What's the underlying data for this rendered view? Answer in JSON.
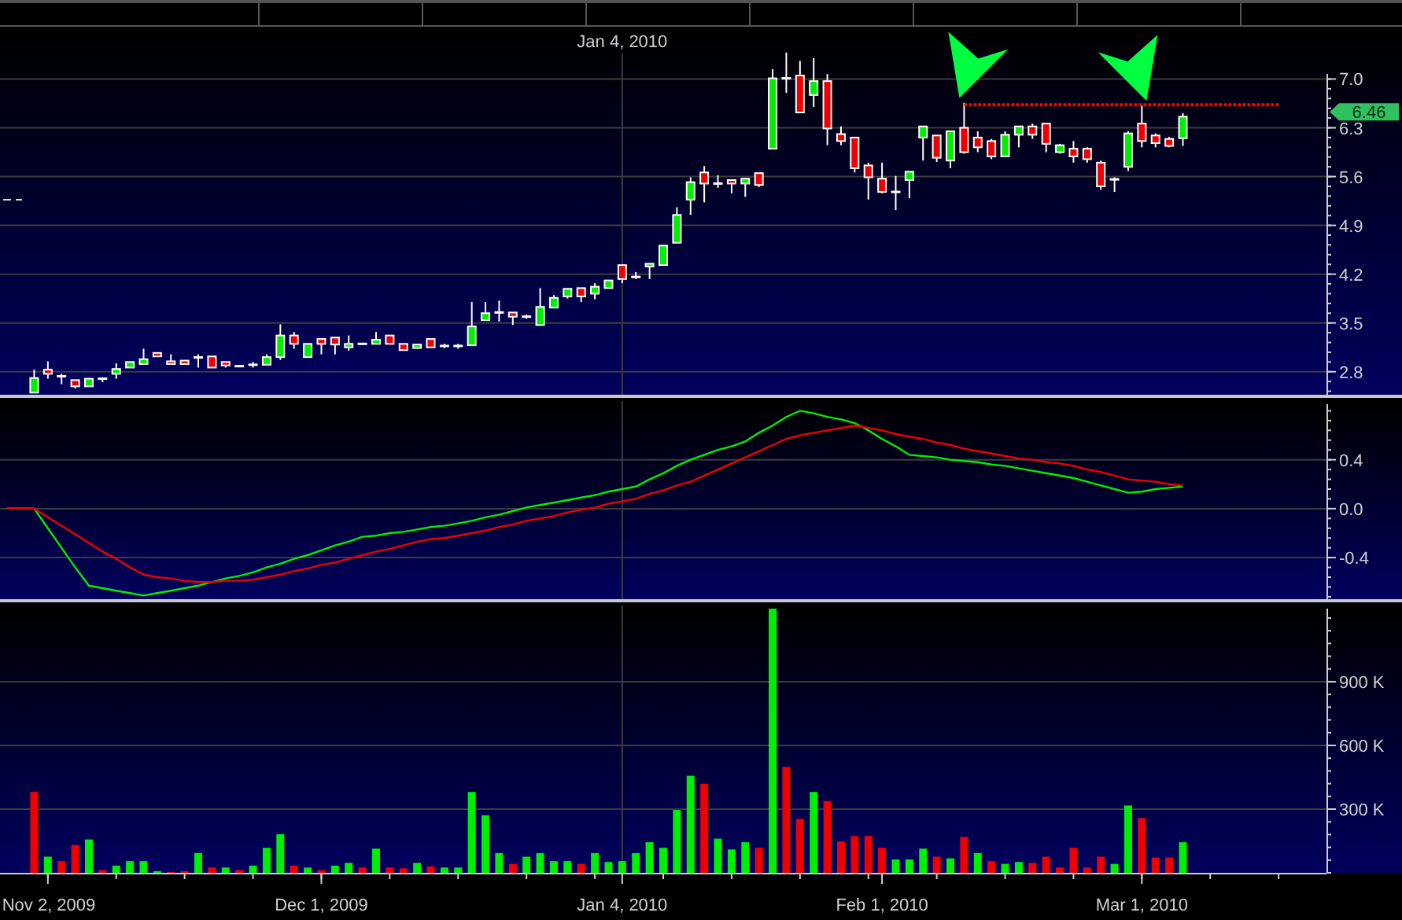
{
  "price_panel": {
    "price_tag": "6.46",
    "chart_data": {
      "type": "candlestick",
      "grid": true,
      "ylim": [
        2.47,
        7.75
      ],
      "categories": [
        null,
        null,
        null,
        null,
        null,
        null,
        null,
        null,
        null,
        null,
        null,
        null,
        null,
        null,
        null,
        null,
        null,
        null,
        null,
        null,
        null,
        null,
        null,
        null,
        null,
        null,
        null,
        null,
        null,
        null,
        null,
        null,
        null,
        null,
        null,
        null,
        null,
        null,
        null,
        null,
        null,
        null,
        null,
        null,
        null,
        null,
        null,
        null,
        null,
        null,
        null,
        null,
        null,
        null,
        null,
        null,
        null,
        null,
        null,
        null,
        null,
        null,
        null,
        null,
        null,
        null,
        null,
        null,
        null,
        null,
        null,
        null,
        null,
        null,
        null,
        null,
        null,
        null,
        null,
        null,
        null,
        null,
        null,
        null,
        null,
        null,
        null,
        null,
        null,
        null,
        null,
        null,
        null,
        null,
        null,
        null,
        null
      ],
      "yticks": [
        {
          "value": 2.8,
          "label": "2.8"
        },
        {
          "value": 3.5,
          "label": "3.5"
        },
        {
          "value": 4.2,
          "label": "4.2"
        },
        {
          "value": 4.9,
          "label": "4.9"
        },
        {
          "value": 5.6,
          "label": "5.6"
        },
        {
          "value": 6.3,
          "label": "6.3"
        },
        {
          "value": 7.0,
          "label": "7.0"
        }
      ],
      "ohlc": [
        null,
        null,
        [
          2.5,
          2.83,
          2.5,
          2.71
        ],
        [
          2.83,
          2.95,
          2.7,
          2.77
        ],
        [
          2.74,
          2.77,
          2.62,
          2.73
        ],
        [
          2.68,
          2.68,
          2.56,
          2.59
        ],
        [
          2.59,
          2.7,
          2.59,
          2.7
        ],
        [
          2.71,
          2.71,
          2.65,
          2.69
        ],
        [
          2.77,
          2.92,
          2.7,
          2.84
        ],
        [
          2.86,
          2.94,
          2.86,
          2.94
        ],
        [
          2.91,
          3.13,
          2.91,
          2.98
        ],
        [
          3.07,
          3.07,
          3.02,
          3.02
        ],
        [
          2.95,
          3.05,
          2.91,
          2.91
        ],
        [
          2.96,
          2.96,
          2.91,
          2.91
        ],
        [
          3.01,
          3.05,
          2.86,
          3.0
        ],
        [
          3.02,
          3.02,
          2.86,
          2.86
        ],
        [
          2.94,
          2.94,
          2.86,
          2.89
        ],
        [
          2.88,
          2.88,
          2.88,
          2.88
        ],
        [
          2.9,
          2.94,
          2.86,
          2.9
        ],
        [
          2.9,
          3.05,
          2.9,
          3.01
        ],
        [
          3.01,
          3.48,
          2.97,
          3.32
        ],
        [
          3.32,
          3.37,
          3.13,
          3.2
        ],
        [
          3.01,
          3.2,
          3.01,
          3.2
        ],
        [
          3.27,
          3.27,
          3.05,
          3.2
        ],
        [
          3.29,
          3.29,
          3.05,
          3.19
        ],
        [
          3.15,
          3.32,
          3.1,
          3.2
        ],
        [
          3.2,
          3.2,
          3.2,
          3.2
        ],
        [
          3.2,
          3.37,
          3.2,
          3.26
        ],
        [
          3.32,
          3.32,
          3.2,
          3.2
        ],
        [
          3.2,
          3.2,
          3.11,
          3.11
        ],
        [
          3.14,
          3.19,
          3.14,
          3.19
        ],
        [
          3.27,
          3.27,
          3.15,
          3.15
        ],
        [
          3.17,
          3.2,
          3.14,
          3.17
        ],
        [
          3.17,
          3.2,
          3.13,
          3.17
        ],
        [
          3.18,
          3.8,
          3.18,
          3.45
        ],
        [
          3.54,
          3.8,
          3.54,
          3.64
        ],
        [
          3.65,
          3.82,
          3.52,
          3.65
        ],
        [
          3.65,
          3.65,
          3.47,
          3.59
        ],
        [
          3.59,
          3.62,
          3.56,
          3.59
        ],
        [
          3.47,
          4.0,
          3.47,
          3.73
        ],
        [
          3.72,
          3.9,
          3.72,
          3.86
        ],
        [
          3.88,
          3.99,
          3.85,
          3.99
        ],
        [
          4.0,
          4.0,
          3.8,
          3.88
        ],
        [
          3.92,
          4.07,
          3.84,
          4.02
        ],
        [
          4.0,
          4.11,
          4.0,
          4.11
        ],
        [
          4.33,
          4.33,
          4.07,
          4.13
        ],
        [
          4.16,
          4.23,
          4.13,
          4.16
        ],
        [
          4.31,
          4.35,
          4.13,
          4.35
        ],
        [
          4.33,
          4.61,
          4.33,
          4.61
        ],
        [
          4.65,
          5.16,
          4.65,
          5.05
        ],
        [
          5.27,
          5.59,
          5.05,
          5.52
        ],
        [
          5.66,
          5.75,
          5.23,
          5.5
        ],
        [
          5.5,
          5.62,
          5.44,
          5.5
        ],
        [
          5.55,
          5.55,
          5.36,
          5.5
        ],
        [
          5.5,
          5.57,
          5.31,
          5.57
        ],
        [
          5.65,
          5.65,
          5.45,
          5.48
        ],
        [
          6.0,
          7.14,
          6.0,
          7.01
        ],
        [
          7.01,
          7.38,
          6.8,
          7.01
        ],
        [
          7.05,
          7.26,
          6.52,
          6.52
        ],
        [
          6.77,
          7.3,
          6.6,
          6.97
        ],
        [
          6.97,
          7.07,
          6.05,
          6.29
        ],
        [
          6.21,
          6.32,
          6.05,
          6.11
        ],
        [
          6.16,
          6.16,
          5.66,
          5.72
        ],
        [
          5.76,
          5.8,
          5.27,
          5.59
        ],
        [
          5.57,
          5.8,
          5.36,
          5.38
        ],
        [
          5.38,
          5.61,
          5.12,
          5.38
        ],
        [
          5.55,
          5.67,
          5.29,
          5.67
        ],
        [
          6.16,
          6.32,
          5.83,
          6.32
        ],
        [
          6.19,
          6.19,
          5.81,
          5.87
        ],
        [
          5.83,
          6.25,
          5.72,
          6.25
        ],
        [
          6.3,
          6.66,
          5.93,
          5.95
        ],
        [
          6.16,
          6.25,
          5.95,
          6.02
        ],
        [
          6.11,
          6.14,
          5.85,
          5.89
        ],
        [
          5.89,
          6.25,
          5.89,
          6.2
        ],
        [
          6.2,
          6.32,
          6.02,
          6.32
        ],
        [
          6.32,
          6.36,
          6.14,
          6.2
        ],
        [
          6.36,
          6.36,
          5.95,
          6.07
        ],
        [
          5.95,
          6.07,
          5.93,
          6.05
        ],
        [
          6.0,
          6.11,
          5.8,
          5.89
        ],
        [
          6.0,
          6.02,
          5.8,
          5.85
        ],
        [
          5.8,
          5.83,
          5.41,
          5.46
        ],
        [
          5.56,
          5.59,
          5.38,
          5.56
        ],
        [
          5.74,
          6.25,
          5.68,
          6.22
        ],
        [
          6.36,
          6.62,
          6.02,
          6.11
        ],
        [
          6.19,
          6.22,
          6.02,
          6.08
        ],
        [
          6.14,
          6.17,
          6.02,
          6.04
        ],
        [
          6.15,
          6.51,
          6.04,
          6.46
        ],
        null,
        null,
        null,
        null,
        null,
        null,
        null,
        null,
        null,
        null
      ],
      "ref_lines": [
        {
          "axis": "y",
          "value": 6.63
        }
      ],
      "annotations": [
        "Jan 4, 2010"
      ]
    }
  },
  "indicator_panel": {
    "chart_data": {
      "type": "line",
      "grid": true,
      "ylim": [
        -0.74,
        0.88
      ],
      "categories": [
        null,
        null,
        null,
        null,
        null,
        null,
        null,
        null,
        null,
        null,
        null,
        null,
        null,
        null,
        null,
        null,
        null,
        null,
        null,
        null,
        null,
        null,
        null,
        null,
        null,
        null,
        null,
        null,
        null,
        null,
        null,
        null,
        null,
        null,
        null,
        null,
        null,
        null,
        null,
        null,
        null,
        null,
        null,
        null,
        null,
        null,
        null,
        null,
        null,
        null,
        null,
        null,
        null,
        null,
        null,
        null,
        null,
        null,
        null,
        null,
        null,
        null,
        null,
        null,
        null,
        null,
        null,
        null,
        null,
        null,
        null,
        null,
        null,
        null,
        null,
        null,
        null,
        null,
        null,
        null,
        null,
        null,
        null,
        null,
        null,
        null,
        null,
        null,
        null,
        null,
        null,
        null,
        null,
        null,
        null,
        null,
        null
      ],
      "yticks": [
        {
          "value": -0.4,
          "label": "-0.4"
        },
        {
          "value": 0,
          "label": "0.0"
        },
        {
          "value": 0.4,
          "label": "0.4"
        }
      ],
      "series": [
        {
          "color": "#00ee00",
          "values": [
            0,
            0,
            0,
            -0.16,
            -0.32,
            -0.48,
            -0.63,
            -0.65,
            -0.67,
            -0.69,
            -0.71,
            -0.69,
            -0.67,
            -0.65,
            -0.63,
            -0.6,
            -0.57,
            -0.55,
            -0.52,
            -0.48,
            -0.45,
            -0.41,
            -0.38,
            -0.34,
            -0.3,
            -0.27,
            -0.23,
            -0.22,
            -0.2,
            -0.19,
            -0.17,
            -0.15,
            -0.14,
            -0.12,
            -0.1,
            -0.07,
            -0.05,
            -0.02,
            0.01,
            0.03,
            0.05,
            0.07,
            0.09,
            0.11,
            0.14,
            0.16,
            0.18,
            0.24,
            0.29,
            0.35,
            0.4,
            0.44,
            0.48,
            0.51,
            0.55,
            0.62,
            0.68,
            0.75,
            0.8,
            0.78,
            0.75,
            0.73,
            0.7,
            0.64,
            0.57,
            0.51,
            0.44,
            0.43,
            0.42,
            0.4,
            0.39,
            0.38,
            0.36,
            0.35,
            0.33,
            0.31,
            0.29,
            0.27,
            0.25,
            0.22,
            0.19,
            0.16,
            0.13,
            0.14,
            0.16,
            0.17,
            0.18,
            null,
            null,
            null,
            null,
            null,
            null,
            null,
            null,
            null,
            null
          ]
        },
        {
          "color": "#ee0000",
          "values": [
            0,
            0,
            0,
            -0.07,
            -0.14,
            -0.21,
            -0.28,
            -0.35,
            -0.41,
            -0.48,
            -0.54,
            -0.56,
            -0.57,
            -0.59,
            -0.6,
            -0.6,
            -0.59,
            -0.59,
            -0.58,
            -0.56,
            -0.54,
            -0.51,
            -0.49,
            -0.46,
            -0.44,
            -0.41,
            -0.38,
            -0.35,
            -0.33,
            -0.3,
            -0.27,
            -0.25,
            -0.24,
            -0.22,
            -0.2,
            -0.18,
            -0.15,
            -0.13,
            -0.1,
            -0.08,
            -0.06,
            -0.03,
            -0.01,
            0.01,
            0.04,
            0.06,
            0.08,
            0.12,
            0.15,
            0.19,
            0.22,
            0.27,
            0.32,
            0.37,
            0.42,
            0.47,
            0.52,
            0.57,
            0.6,
            0.62,
            0.64,
            0.66,
            0.68,
            0.66,
            0.64,
            0.61,
            0.59,
            0.57,
            0.54,
            0.52,
            0.49,
            0.47,
            0.45,
            0.43,
            0.41,
            0.4,
            0.38,
            0.37,
            0.35,
            0.32,
            0.3,
            0.27,
            0.24,
            0.23,
            0.22,
            0.2,
            0.19,
            null,
            null,
            null,
            null,
            null,
            null,
            null,
            null,
            null,
            null
          ]
        }
      ]
    }
  },
  "volume_panel": {
    "chart_data": {
      "type": "bar",
      "grid": true,
      "ylim": [
        0,
        1259000
      ],
      "categories": [
        null,
        null,
        null,
        "Nov 2, 2009",
        null,
        null,
        null,
        null,
        null,
        null,
        null,
        null,
        null,
        null,
        null,
        null,
        null,
        null,
        null,
        null,
        null,
        null,
        null,
        "Dec 1, 2009",
        null,
        null,
        null,
        null,
        null,
        null,
        null,
        null,
        null,
        null,
        null,
        null,
        null,
        null,
        null,
        null,
        null,
        null,
        null,
        null,
        null,
        "Jan 4, 2010",
        null,
        null,
        null,
        null,
        null,
        null,
        null,
        null,
        null,
        null,
        null,
        null,
        null,
        null,
        null,
        null,
        null,
        null,
        "Feb 1, 2010",
        null,
        null,
        null,
        null,
        null,
        null,
        null,
        null,
        null,
        null,
        null,
        null,
        null,
        null,
        null,
        null,
        null,
        null,
        "Mar 1, 2010",
        null,
        null,
        null,
        null,
        null,
        null,
        null,
        null,
        null,
        null,
        null,
        null,
        null
      ],
      "yticks": [
        {
          "value": 300000,
          "label": "300 K"
        },
        {
          "value": 600000,
          "label": "600 K"
        },
        {
          "value": 900000,
          "label": "900 K"
        }
      ],
      "series": [
        {
          "color": "#00ee00",
          "values": [
            null,
            null,
            null,
            76000,
            null,
            null,
            157000,
            null,
            34000,
            55000,
            55000,
            8000,
            null,
            null,
            93000,
            null,
            25000,
            null,
            34000,
            118000,
            182000,
            null,
            25000,
            null,
            34000,
            47000,
            null,
            114000,
            null,
            null,
            47000,
            null,
            25000,
            25000,
            381000,
            271000,
            93000,
            null,
            76000,
            93000,
            55000,
            55000,
            null,
            93000,
            51000,
            55000,
            93000,
            144000,
            118000,
            296000,
            457000,
            null,
            161000,
            110000,
            144000,
            null,
            1244000,
            null,
            null,
            381000,
            null,
            null,
            null,
            null,
            null,
            63000,
            63000,
            114000,
            null,
            68000,
            null,
            93000,
            null,
            42000,
            51000,
            null,
            null,
            null,
            null,
            null,
            null,
            42000,
            317000,
            null,
            null,
            null,
            144000,
            null,
            null,
            null,
            null,
            null,
            null,
            null,
            null,
            null,
            null
          ]
        },
        {
          "color": "#ee0000",
          "values": [
            null,
            null,
            381000,
            null,
            55000,
            131000,
            null,
            13000,
            null,
            null,
            null,
            null,
            4000,
            8000,
            null,
            25000,
            null,
            13000,
            null,
            null,
            null,
            34000,
            null,
            13000,
            null,
            null,
            25000,
            null,
            25000,
            21000,
            null,
            30000,
            null,
            null,
            null,
            null,
            null,
            42000,
            null,
            null,
            null,
            null,
            42000,
            null,
            null,
            null,
            null,
            null,
            null,
            null,
            null,
            419000,
            null,
            null,
            null,
            118000,
            null,
            499000,
            254000,
            null,
            338000,
            148000,
            173000,
            173000,
            118000,
            null,
            null,
            null,
            76000,
            null,
            169000,
            null,
            55000,
            null,
            null,
            47000,
            76000,
            25000,
            118000,
            25000,
            76000,
            null,
            null,
            258000,
            72000,
            72000,
            null,
            null,
            null,
            null,
            null,
            null,
            null,
            null,
            null,
            null,
            null
          ]
        }
      ]
    }
  }
}
